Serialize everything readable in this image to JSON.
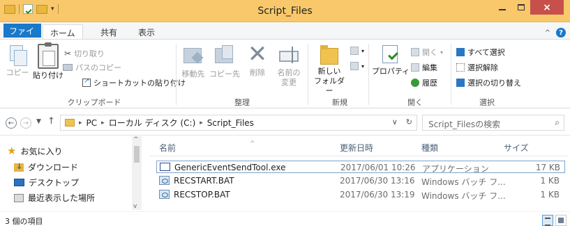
{
  "window": {
    "title": "Script_Files",
    "close_glyph": "×"
  },
  "ribbon_tabs": [
    "ファイル",
    "ホーム",
    "共有",
    "表示"
  ],
  "ribbon": {
    "clipboard": {
      "copy": "コピー",
      "paste": "貼り付け",
      "cut": "切り取り",
      "copy_path": "パスのコピー",
      "paste_shortcut": "ショートカットの貼り付け",
      "group": "クリップボード"
    },
    "organize": {
      "move_to": "移動先",
      "copy_to": "コピー先",
      "delete": "削除",
      "rename_line1": "名前の",
      "rename_line2": "変更",
      "group": "整理"
    },
    "new": {
      "new_folder_line1": "新しい",
      "new_folder_line2": "フォルダー",
      "group": "新規"
    },
    "open": {
      "properties": "プロパティ",
      "open": "開く",
      "edit": "編集",
      "history": "履歴",
      "group": "開く"
    },
    "select": {
      "select_all": "すべて選択",
      "select_none": "選択解除",
      "invert": "選択の切り替え",
      "group": "選択"
    }
  },
  "address": {
    "crumbs": [
      "PC",
      "ローカル ディスク (C:)",
      "Script_Files"
    ],
    "search_placeholder": "Script_Filesの検索"
  },
  "nav_pane": {
    "favorites": "お気に入り",
    "items": [
      "ダウンロード",
      "デスクトップ",
      "最近表示した場所"
    ]
  },
  "file_list": {
    "columns": [
      "名前",
      "更新日時",
      "種類",
      "サイズ"
    ],
    "rows": [
      {
        "name": "GenericEventSendTool.exe",
        "date": "2017/06/01 10:26",
        "type": "アプリケーション",
        "size": "17 KB",
        "selected": true
      },
      {
        "name": "RECSTART.BAT",
        "date": "2017/06/30 13:16",
        "type": "Windows バッチ フ...",
        "size": "1 KB",
        "selected": false
      },
      {
        "name": "RECSTOP.BAT",
        "date": "2017/06/30 13:19",
        "type": "Windows バッチ フ...",
        "size": "1 KB",
        "selected": false
      }
    ]
  },
  "status": {
    "item_count": "3 個の項目"
  },
  "colors": {
    "titlebar": "#f8c86b",
    "file_tab": "#1979ca",
    "close_button": "#c7504b",
    "selection_border": "#7da2ce"
  }
}
